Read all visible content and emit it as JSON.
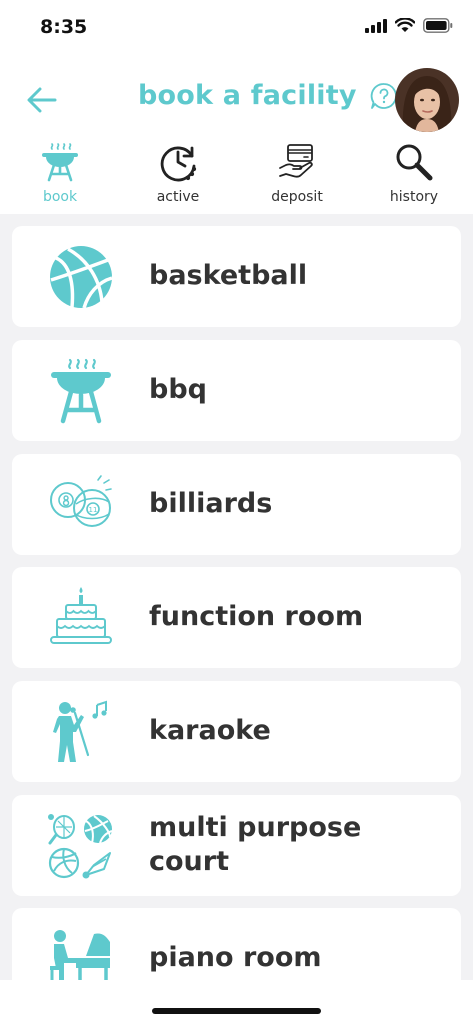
{
  "status": {
    "time": "8:35"
  },
  "header": {
    "title": "book a facility"
  },
  "tabs": [
    {
      "label": "book",
      "icon": "bbq-icon",
      "active": true
    },
    {
      "label": "active",
      "icon": "clock-icon",
      "active": false
    },
    {
      "label": "deposit",
      "icon": "deposit-hand-icon",
      "active": false
    },
    {
      "label": "history",
      "icon": "magnifier-icon",
      "active": false
    }
  ],
  "facilities": [
    {
      "label": "basketball",
      "icon": "basketball-icon"
    },
    {
      "label": "bbq",
      "icon": "bbq-grill-icon"
    },
    {
      "label": "billiards",
      "icon": "billiard-balls-icon"
    },
    {
      "label": "function room",
      "icon": "cake-icon"
    },
    {
      "label": "karaoke",
      "icon": "singer-icon"
    },
    {
      "label": "multi purpose",
      "label2": "court",
      "icon": "sports-balls-icon"
    },
    {
      "label": "piano room",
      "icon": "piano-icon"
    }
  ],
  "colors": {
    "accent": "#5ec9cd",
    "text": "#333333",
    "background": "#f2f2f4"
  }
}
